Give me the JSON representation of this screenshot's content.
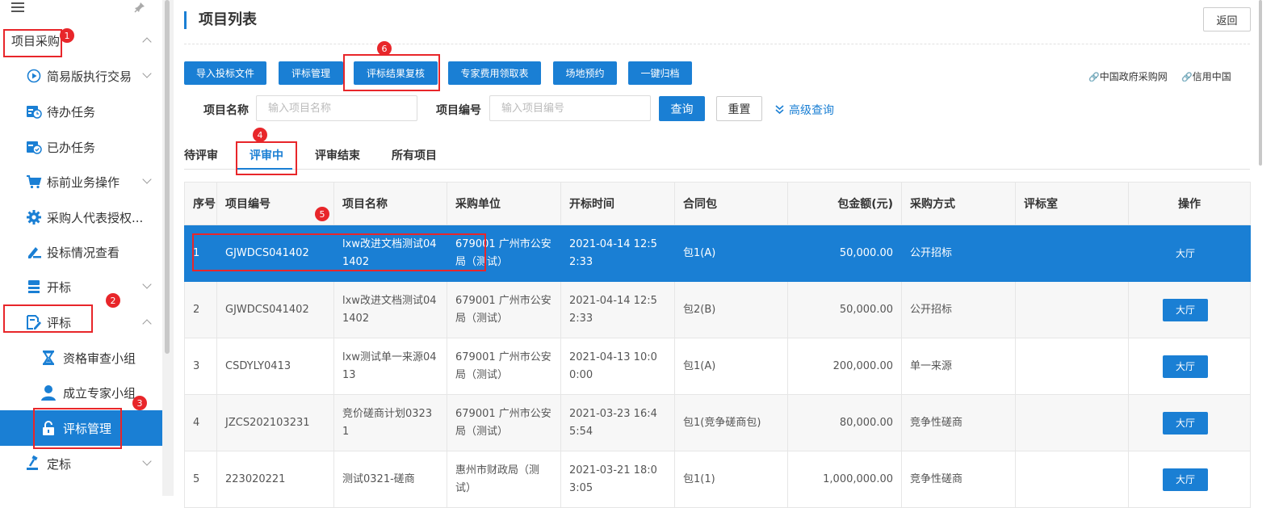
{
  "sidebar": {
    "menu_icon": "hamburger-icon",
    "pin_icon": "pin-icon",
    "section": "项目采购",
    "items": [
      {
        "label": "简易版执行交易",
        "icon": "play-circle-icon"
      },
      {
        "label": "待办任务",
        "icon": "calendar-clock-icon"
      },
      {
        "label": "已办任务",
        "icon": "calendar-check-icon"
      },
      {
        "label": "标前业务操作",
        "icon": "cart-icon"
      },
      {
        "label": "采购人代表授权...",
        "icon": "gear-icon"
      },
      {
        "label": "投标情况查看",
        "icon": "edit-icon"
      },
      {
        "label": "开标",
        "icon": "stack-icon"
      },
      {
        "label": "评标",
        "icon": "edit-doc-icon"
      },
      {
        "label": "资格审查小组",
        "icon": "hourglass-icon"
      },
      {
        "label": "成立专家小组",
        "icon": "user-icon"
      },
      {
        "label": "评标管理",
        "icon": "lock-icon"
      },
      {
        "label": "定标",
        "icon": "gavel-icon"
      }
    ]
  },
  "header": {
    "title": "项目列表",
    "back": "返回"
  },
  "toolbar": {
    "buttons": [
      "导入投标文件",
      "评标管理",
      "评标结果复核",
      "专家费用领取表",
      "场地预约",
      "一键归档"
    ],
    "links": [
      "中国政府采购网",
      "信用中国"
    ]
  },
  "filter": {
    "name_label": "项目名称",
    "name_placeholder": "输入项目名称",
    "code_label": "项目编号",
    "code_placeholder": "输入项目编号",
    "query": "查询",
    "reset": "重置",
    "advanced": "高级查询"
  },
  "tabs": [
    "待评审",
    "评审中",
    "评审结束",
    "所有项目"
  ],
  "table": {
    "headers": [
      "序号",
      "项目编号",
      "项目名称",
      "采购单位",
      "开标时间",
      "合同包",
      "包金额(元)",
      "采购方式",
      "评标室",
      "操作"
    ],
    "rows": [
      [
        "1",
        "GJWDCS041402",
        "lxw改进文档测试041402",
        "679001 广州市公安局（测试）",
        "2021-04-14 12:52:33",
        "包1(A)",
        "50,000.00",
        "公开招标",
        "",
        "大厅"
      ],
      [
        "2",
        "GJWDCS041402",
        "lxw改进文档测试041402",
        "679001 广州市公安局（测试）",
        "2021-04-14 12:52:33",
        "包2(B)",
        "50,000.00",
        "公开招标",
        "",
        "大厅"
      ],
      [
        "3",
        "CSDYLY0413",
        "lxw测试单一来源0413",
        "679001 广州市公安局（测试）",
        "2021-04-13 10:00:00",
        "包1(A)",
        "200,000.00",
        "单一来源",
        "",
        "大厅"
      ],
      [
        "4",
        "JZCS202103231",
        "竞价磋商计划03231",
        "679001 广州市公安局（测试）",
        "2021-03-23 16:45:54",
        "包1(竞争磋商包)",
        "80,000.00",
        "竞争性磋商",
        "",
        "大厅"
      ],
      [
        "5",
        "223020221",
        "测试0321-磋商",
        "惠州市财政局（测试）",
        "2021-03-21 18:03:05",
        "包1(1)",
        "1,000,000.00",
        "竞争性磋商",
        "",
        "大厅"
      ]
    ]
  },
  "annotations": [
    "1",
    "2",
    "3",
    "4",
    "5",
    "6"
  ],
  "colors": {
    "accent": "#1a7fd4",
    "highlight": "#e8262a"
  }
}
